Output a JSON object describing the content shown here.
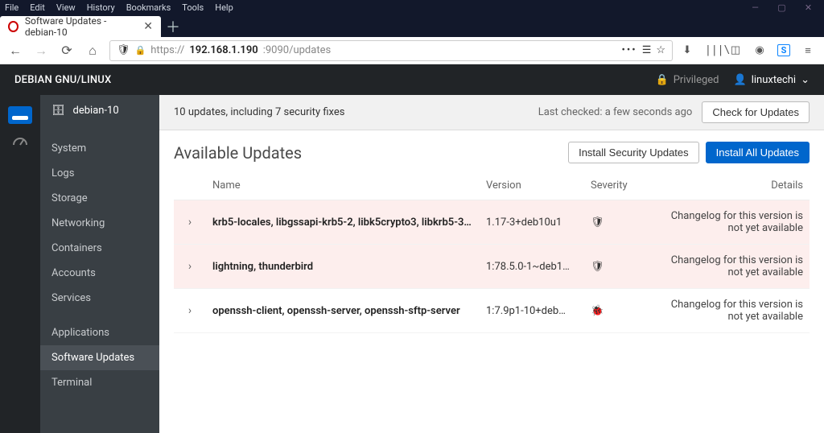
{
  "os_menu": [
    "File",
    "Edit",
    "View",
    "History",
    "Bookmarks",
    "Tools",
    "Help"
  ],
  "tab": {
    "title": "Software Updates - debian-10"
  },
  "url": {
    "scheme": "https://",
    "host": "192.168.1.190",
    "suffix": ":9090/updates"
  },
  "header": {
    "title": "DEBIAN GNU/LINUX",
    "priv": "Privileged",
    "user": "linuxtechi"
  },
  "host": {
    "name": "debian-10"
  },
  "sidebar": {
    "items": [
      {
        "label": "System"
      },
      {
        "label": "Logs"
      },
      {
        "label": "Storage"
      },
      {
        "label": "Networking"
      },
      {
        "label": "Containers"
      },
      {
        "label": "Accounts"
      },
      {
        "label": "Services"
      },
      {
        "label": "Applications"
      },
      {
        "label": "Software Updates",
        "active": true
      },
      {
        "label": "Terminal"
      }
    ]
  },
  "toolbar": {
    "summary": "10 updates, including 7 security fixes",
    "last_checked_label": "Last checked: a few seconds ago",
    "check_btn": "Check for Updates"
  },
  "page": {
    "title": "Available Updates",
    "install_security": "Install Security Updates",
    "install_all": "Install All Updates"
  },
  "table": {
    "columns": {
      "name": "Name",
      "version": "Version",
      "severity": "Severity",
      "details": "Details"
    },
    "rows": [
      {
        "name": "krb5-locales, libgssapi-krb5-2, libk5crypto3, libkrb5-3, …",
        "version": "1.17-3+deb10u1",
        "severity": "security",
        "details": "Changelog for this version is not yet available"
      },
      {
        "name": "lightning, thunderbird",
        "version": "1:78.5.0-1~deb1…",
        "severity": "security",
        "details": "Changelog for this version is not yet available"
      },
      {
        "name": "openssh-client, openssh-server, openssh-sftp-server",
        "version": "1:7.9p1-10+deb…",
        "severity": "bug",
        "details": "Changelog for this version is not yet available"
      }
    ]
  }
}
